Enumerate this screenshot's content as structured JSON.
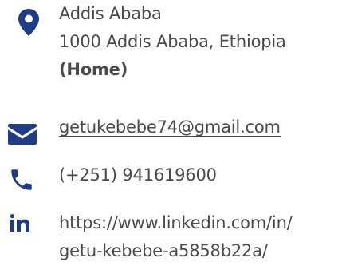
{
  "contact": {
    "address": {
      "icon": "location-pin-icon",
      "line1": "Addis Ababa",
      "line2": "1000 Addis Ababa, Ethiopia",
      "line3": "(Home)"
    },
    "email": {
      "icon": "envelope-icon",
      "label": "getukebebe74@gmail.com"
    },
    "phone": {
      "icon": "phone-icon",
      "label": "(+251) 941619600"
    },
    "linkedin": {
      "icon": "linkedin-icon",
      "line1": "https://www.linkedin.com/in/",
      "line2": "getu-kebebe-a5858b22a/"
    }
  },
  "colors": {
    "icon": "#1f3c88",
    "text": "#4a4a4a"
  }
}
